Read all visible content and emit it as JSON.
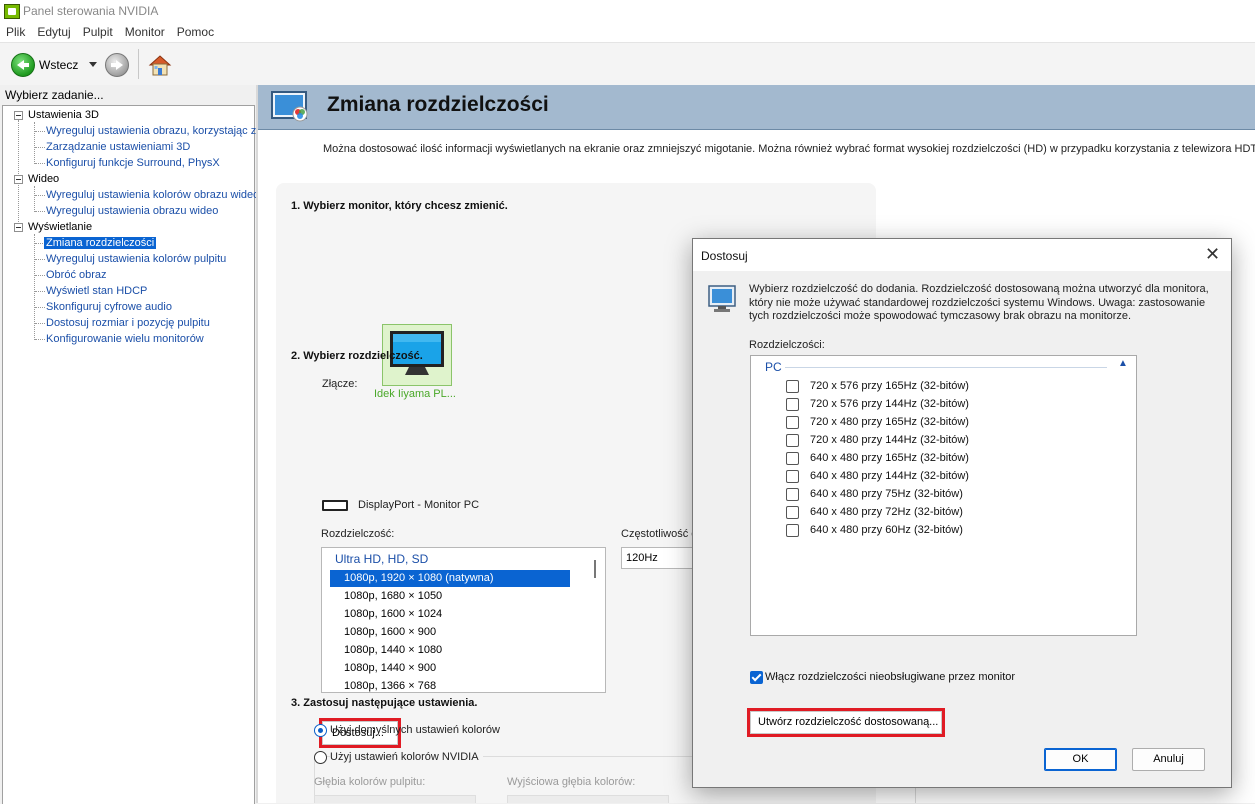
{
  "window": {
    "title": "Panel sterowania NVIDIA"
  },
  "menu": [
    "Plik",
    "Edytuj",
    "Pulpit",
    "Monitor",
    "Pomoc"
  ],
  "toolbar": {
    "back_label": "Wstecz"
  },
  "sidebar": {
    "header": "Wybierz zadanie...",
    "groups": [
      {
        "label": "Ustawienia 3D",
        "items": [
          "Wyreguluj ustawienia obrazu, korzystając z",
          "Zarządzanie ustawieniami 3D",
          "Konfiguruj funkcje Surround, PhysX"
        ]
      },
      {
        "label": "Wideo",
        "items": [
          "Wyreguluj ustawienia kolorów obrazu wideo",
          "Wyreguluj ustawienia obrazu wideo"
        ]
      },
      {
        "label": "Wyświetlanie",
        "items": [
          "Zmiana rozdzielczości",
          "Wyreguluj ustawienia kolorów pulpitu",
          "Obróć obraz",
          "Wyświetl stan HDCP",
          "Skonfiguruj cyfrowe audio",
          "Dostosuj rozmiar i pozycję pulpitu",
          "Konfigurowanie wielu monitorów"
        ]
      }
    ],
    "selected": "Zmiana rozdzielczości"
  },
  "main": {
    "title": "Zmiana rozdzielczości",
    "description": "Można dostosować ilość informacji wyświetlanych na ekranie oraz zmniejszyć migotanie. Można również wybrać format wysokiej rozdzielczości (HD) w przypadku korzystania z telewizora HDTV oraz u",
    "step1": "1. Wybierz monitor, który chcesz zmienić.",
    "monitor_name": "Idek Iiyama PL...",
    "step2": "2. Wybierz rozdzielczość.",
    "connector_label": "Złącze:",
    "connector_value": "DisplayPort - Monitor PC",
    "resolution_label": "Rozdzielczość:",
    "refresh_label": "Częstotliwość odśw",
    "refresh_value": "120Hz",
    "resolution_category": "Ultra HD, HD, SD",
    "resolutions": [
      "1080p, 1920 × 1080 (natywna)",
      "1080p, 1680 × 1050",
      "1080p, 1600 × 1024",
      "1080p, 1600 × 900",
      "1080p, 1440 × 1080",
      "1080p, 1440 × 900",
      "1080p, 1366 × 768"
    ],
    "selected_resolution": "1080p, 1920 × 1080 (natywna)",
    "customize_button": "Dostosuj...",
    "step3": "3. Zastosuj następujące ustawienia.",
    "radio_default": "Użyj domyślnych ustawień kolorów",
    "radio_nvidia": "Użyj ustawień kolorów NVIDIA",
    "desktop_depth_label": "Głębia kolorów pulpitu:",
    "output_depth_label": "Wyjściowa głębia kolorów:"
  },
  "dialog": {
    "title": "Dostosuj",
    "description": "Wybierz rozdzielczość do dodania. Rozdzielczość dostosowaną można utworzyć dla monitora, który nie może używać standardowej rozdzielczości systemu Windows. Uwaga: zastosowanie tych rozdzielczości może spowodować tymczasowy brak obrazu na monitorze.",
    "resolutions_label": "Rozdzielczości:",
    "group": "PC",
    "items": [
      "720 x 576 przy 165Hz (32-bitów)",
      "720 x 576 przy 144Hz (32-bitów)",
      "720 x 480 przy 165Hz (32-bitów)",
      "720 x 480 przy 144Hz (32-bitów)",
      "640 x 480 przy 165Hz (32-bitów)",
      "640 x 480 przy 144Hz (32-bitów)",
      "640 x 480 przy 75Hz (32-bitów)",
      "640 x 480 przy 72Hz (32-bitów)",
      "640 x 480 przy 60Hz (32-bitów)"
    ],
    "checkbox_unsupported": "Włącz rozdzielczości nieobsługiwane przez monitor",
    "checkbox_unsupported_checked": true,
    "create_button": "Utwórz rozdzielczość dostosowaną...",
    "ok_button": "OK",
    "cancel_button": "Anuluj"
  },
  "colors": {
    "accent": "#0a64d2",
    "highlight_box": "#e01b24",
    "nvidia_green": "#76b900",
    "banner": "#a3b9cf"
  }
}
